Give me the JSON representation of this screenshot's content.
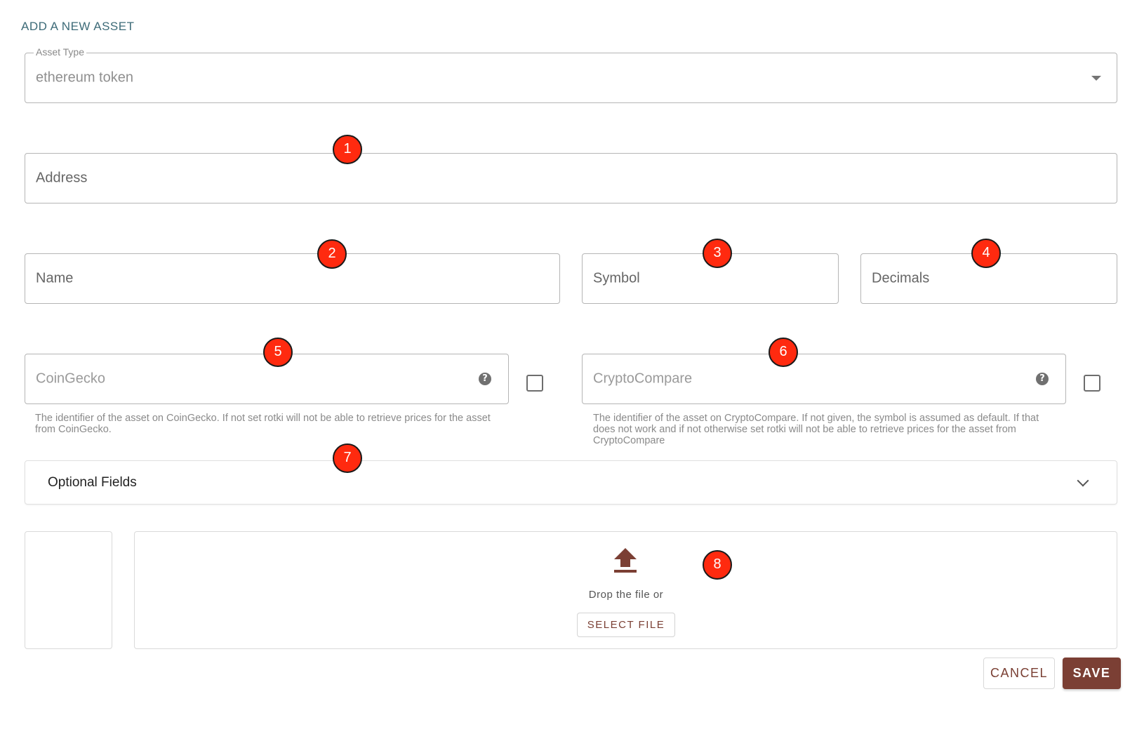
{
  "dialog": {
    "title": "ADD A NEW ASSET"
  },
  "asset_type": {
    "legend": "Asset Type",
    "value": "ethereum token"
  },
  "fields": {
    "address": "Address",
    "name": "Name",
    "symbol": "Symbol",
    "decimals": "Decimals",
    "coingecko": "CoinGecko",
    "cryptocompare": "CryptoCompare"
  },
  "hints": {
    "coingecko": "The identifier of the asset on CoinGecko. If not set rotki will not be able to retrieve prices for the asset from CoinGecko.",
    "cryptocompare": "The identifier of the asset on CryptoCompare. If not given, the symbol is assumed as default. If that does not work and if not otherwise set rotki will not be able to retrieve prices for the asset from CryptoCompare"
  },
  "optional_fields": {
    "title": "Optional Fields"
  },
  "upload": {
    "drop_text": "Drop the file or",
    "select_file_label": "SELECT FILE"
  },
  "actions": {
    "cancel_label": "CANCEL",
    "save_label": "SAVE"
  },
  "badges": [
    "1",
    "2",
    "3",
    "4",
    "5",
    "6",
    "7",
    "8"
  ],
  "icons": {
    "dropdown": "caret-down-icon",
    "help": "question-circle-icon",
    "expand": "chevron-down-icon",
    "upload": "upload-icon"
  },
  "colors": {
    "title": "#3d6b78",
    "primary": "#7b3f34",
    "badge": "#ff2a0f"
  }
}
